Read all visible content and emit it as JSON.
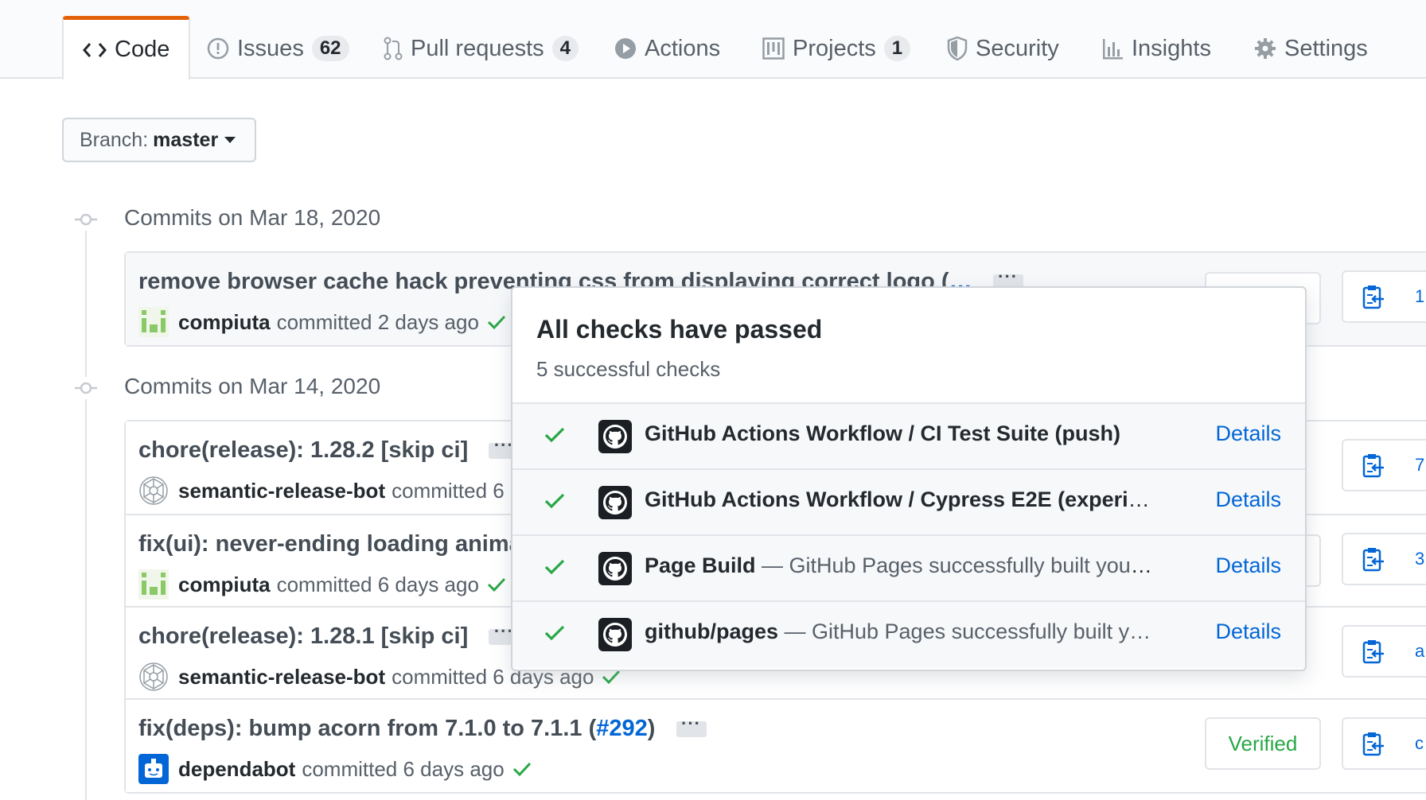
{
  "tabs": [
    {
      "label": "Code",
      "icon": "code-icon",
      "selected": true
    },
    {
      "label": "Issues",
      "icon": "issue-opened-icon",
      "count": "62"
    },
    {
      "label": "Pull requests",
      "icon": "git-pull-request-icon",
      "count": "4"
    },
    {
      "label": "Actions",
      "icon": "play-icon"
    },
    {
      "label": "Projects",
      "icon": "project-icon",
      "count": "1"
    },
    {
      "label": "Security",
      "icon": "shield-icon"
    },
    {
      "label": "Insights",
      "icon": "graph-icon"
    },
    {
      "label": "Settings",
      "icon": "gear-icon"
    }
  ],
  "branch": {
    "label": "Branch:",
    "value": "master"
  },
  "groups": [
    {
      "title": "Commits on Mar 18, 2020",
      "commits": [
        {
          "title": "remove browser cache hack preventing css from displaying correct logo (",
          "title_link": "…",
          "author": "compiuta",
          "meta": "committed 2 days ago"
        }
      ]
    },
    {
      "title": "Commits on Mar 14, 2020",
      "commits": [
        {
          "title": "chore(release): 1.28.2 [skip ci]",
          "author": "semantic-release-bot",
          "meta": "committed 6 days ago"
        },
        {
          "title": "fix(ui): never-ending loading animation",
          "author": "compiuta",
          "meta": "committed 6 days ago"
        },
        {
          "title": "chore(release): 1.28.1 [skip ci]",
          "author": "semantic-release-bot",
          "meta": "committed 6 days ago"
        },
        {
          "title_prefix": "fix(deps): bump acorn from 7.1.0 to 7.1.1 (",
          "title_link": "#292",
          "title_suffix": ")",
          "author": "dependabot",
          "meta": "committed 6 days ago",
          "verified": "Verified"
        }
      ]
    }
  ],
  "popover": {
    "title": "All checks have passed",
    "subtitle": "5 successful checks",
    "checks": [
      {
        "name": "GitHub Actions Workflow / CI Test Suite (push)",
        "desc": "",
        "details": "Details"
      },
      {
        "name": "GitHub Actions Workflow / Cypress E2E (experim…",
        "desc": "",
        "details": "Details"
      },
      {
        "name": "Page Build",
        "desc": " — GitHub Pages successfully built your …",
        "details": "Details"
      },
      {
        "name": "github/pages",
        "desc": " — GitHub Pages successfully built y…",
        "details": "Details"
      }
    ]
  },
  "colors": {
    "accent": "#e36209",
    "link": "#0366d6",
    "success": "#28a745"
  }
}
